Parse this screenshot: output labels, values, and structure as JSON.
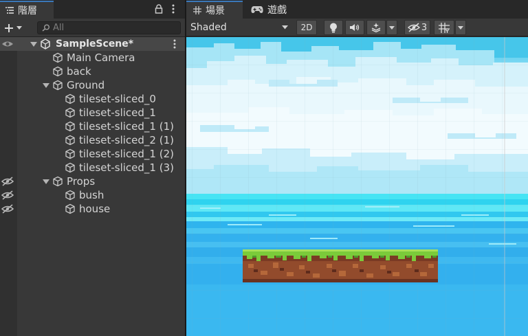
{
  "hierarchy": {
    "tab_label": "階層",
    "search": {
      "placeholder": "All",
      "value": ""
    },
    "scene_name": "SampleScene*",
    "items": [
      {
        "label": "Main Camera",
        "depth": 1,
        "hidden": false,
        "expandable": false
      },
      {
        "label": "back",
        "depth": 1,
        "hidden": false,
        "expandable": false
      },
      {
        "label": "Ground",
        "depth": 1,
        "hidden": false,
        "expandable": true
      },
      {
        "label": "tileset-sliced_0",
        "depth": 2,
        "hidden": false,
        "expandable": false
      },
      {
        "label": "tileset-sliced_1",
        "depth": 2,
        "hidden": false,
        "expandable": false
      },
      {
        "label": "tileset-sliced_1 (1)",
        "depth": 2,
        "hidden": false,
        "expandable": false
      },
      {
        "label": "tileset-sliced_2 (1)",
        "depth": 2,
        "hidden": false,
        "expandable": false
      },
      {
        "label": "tileset-sliced_1 (2)",
        "depth": 2,
        "hidden": false,
        "expandable": false
      },
      {
        "label": "tileset-sliced_1 (3)",
        "depth": 2,
        "hidden": false,
        "expandable": false
      },
      {
        "label": "Props",
        "depth": 1,
        "hidden": true,
        "expandable": true
      },
      {
        "label": "bush",
        "depth": 2,
        "hidden": true,
        "expandable": false
      },
      {
        "label": "house",
        "depth": 2,
        "hidden": true,
        "expandable": false
      }
    ]
  },
  "scene_view": {
    "tabs": [
      {
        "label": "場景",
        "icon": "grid-icon",
        "active": true
      },
      {
        "label": "遊戲",
        "icon": "gamepad-icon",
        "active": false
      }
    ],
    "shading_mode": "Shaded",
    "mode_2d_label": "2D",
    "hidden_count": "3"
  },
  "colors": {
    "accent": "#3a79bb",
    "sky_top": "#37c1e6",
    "sky": "#9be6f8",
    "cloud": "#e8f7fc",
    "sea": "#3ab6ee",
    "grass": "#7ccb3b",
    "dirt": "#8f4a2b"
  }
}
